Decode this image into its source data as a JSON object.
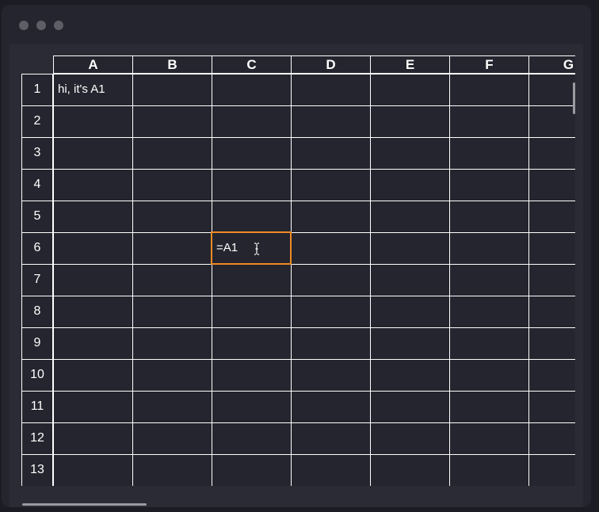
{
  "window": {
    "traffic_lights": [
      "close",
      "minimize",
      "zoom"
    ]
  },
  "sheet": {
    "columns": [
      "A",
      "B",
      "C",
      "D",
      "E",
      "F",
      "G"
    ],
    "rows": [
      "1",
      "2",
      "3",
      "4",
      "5",
      "6",
      "7",
      "8",
      "9",
      "10",
      "11",
      "12",
      "13"
    ],
    "cells": {
      "A1": "hi, it's A1",
      "C6": "=A1"
    },
    "editing_cell": "C6",
    "editing_color": "#f08a24"
  }
}
